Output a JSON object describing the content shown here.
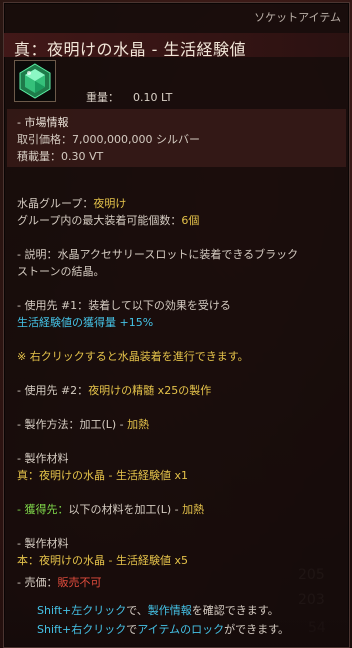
{
  "category": "ソケットアイテム",
  "title": "真：夜明けの水晶 - 生活経験値",
  "icon": "green-crystal-icon",
  "weight": {
    "label": "重量：",
    "value": "0.10 LT"
  },
  "market": {
    "header": "- 市場情報",
    "price_label": "取引価格：",
    "price_value": "7,000,000,000 シルバー",
    "capacity": "積載量：0.30 VT"
  },
  "group": {
    "label": "水晶グループ：",
    "value": "夜明け"
  },
  "max_equip": {
    "label": "グループ内の最大装着可能個数：",
    "value": "6個"
  },
  "description": {
    "line1_prefix": "- 説明：",
    "line1_text": "水晶アクセサリースロットに装着できるブラック",
    "line2": "ストーンの結晶。"
  },
  "use1": {
    "prefix": "- 使用先 #1：",
    "text": "装着して以下の効果を受ける",
    "effect": "生活経験値の獲得量 +15%"
  },
  "right_click_note": "※ 右クリックすると水晶装着を進行できます。",
  "use2": {
    "prefix": "- 使用先 #2：",
    "text": "夜明けの精髄 x25の製作"
  },
  "craft_method": {
    "prefix": "- 製作方法：",
    "method": "加工(L)",
    "sep": " - ",
    "type": "加熱"
  },
  "materials1": {
    "header": "- 製作材料",
    "item": "真：夜明けの水晶 - 生活経験値 x1"
  },
  "obtain": {
    "prefix": "- 獲得先：",
    "text": "以下の材料を加工(L) - ",
    "type": "加熱"
  },
  "materials2": {
    "header": "- 製作材料",
    "item": "本：夜明けの水晶 - 生活経験値 x5"
  },
  "sell": {
    "prefix": "- 売価：",
    "value": "販売不可"
  },
  "hints": {
    "line1_key": "Shift+左クリック",
    "line1_mid": "で、",
    "line1_link": "製作情報",
    "line1_tail": "を確認できます。",
    "line2_key": "Shift+右クリック",
    "line2_mid": "で",
    "line2_link": "アイテムのロック",
    "line2_tail": "ができます。"
  },
  "background_numbers": [
    "205",
    "203",
    "54"
  ],
  "colors": {
    "gold": "#e4c24a",
    "cyan": "#45c2e6",
    "green": "#7fd84a",
    "red": "#e24d3d"
  }
}
